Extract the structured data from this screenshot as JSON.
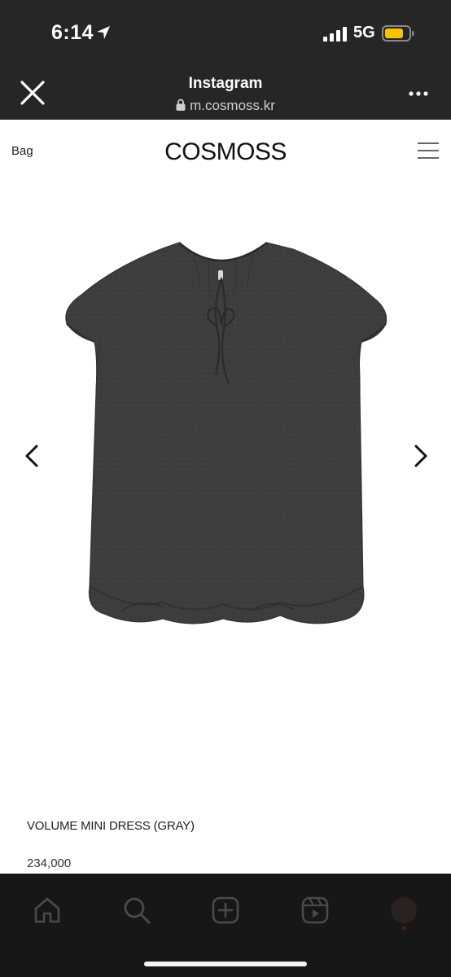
{
  "status_bar": {
    "time": "6:14",
    "network": "5G",
    "icons": [
      "location-arrow-icon",
      "signal-icon",
      "battery-icon"
    ],
    "battery_color": "#f5c400"
  },
  "browser_header": {
    "title": "Instagram",
    "url": "m.cosmoss.kr",
    "close_icon": "close-icon",
    "more_icon": "more-icon"
  },
  "site_header": {
    "left_link": "Bag",
    "logo": "COSMOSS",
    "menu_icon": "hamburger-menu-icon"
  },
  "product": {
    "image_icon": "dress-image",
    "name": "VOLUME MINI DRESS (GRAY)",
    "price": "234,000",
    "prev_icon": "chevron-left-icon",
    "next_icon": "chevron-right-icon",
    "dress_color": "#3c3d3f"
  },
  "tab_bar": {
    "tabs": [
      "home-icon",
      "search-icon",
      "create-icon",
      "reels-icon",
      "profile-avatar"
    ]
  }
}
